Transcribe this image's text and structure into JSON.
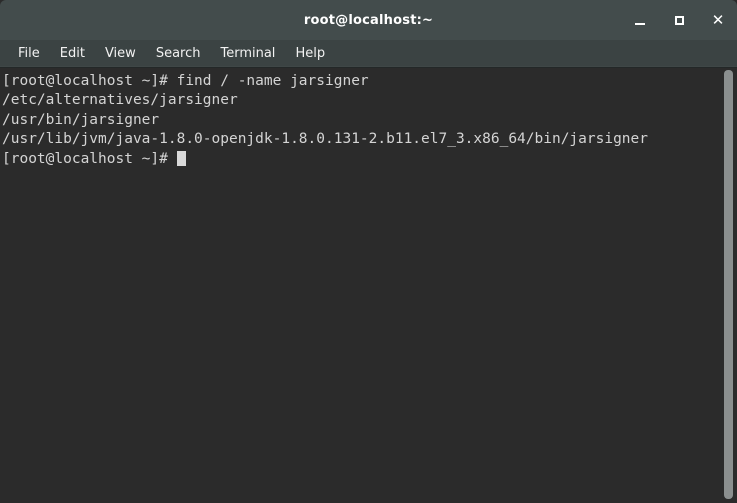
{
  "window": {
    "title": "root@localhost:~",
    "controls": {
      "minimize_label": "_",
      "maximize_label": "□",
      "close_label": "✕"
    }
  },
  "menubar": {
    "items": [
      {
        "label": "File"
      },
      {
        "label": "Edit"
      },
      {
        "label": "View"
      },
      {
        "label": "Search"
      },
      {
        "label": "Terminal"
      },
      {
        "label": "Help"
      }
    ]
  },
  "terminal": {
    "lines": [
      "[root@localhost ~]# find / -name jarsigner",
      "/etc/alternatives/jarsigner",
      "/usr/bin/jarsigner",
      "/usr/lib/jvm/java-1.8.0-openjdk-1.8.0.131-2.b11.el7_3.x86_64/bin/jarsigner"
    ],
    "prompt": "[root@localhost ~]# ",
    "foreground_color": "#d4d4d4",
    "background_color": "#2b2b2b"
  },
  "colors": {
    "titlebar": "#434c4c",
    "menubar": "#3b4343",
    "terminal_bg": "#2b2b2b",
    "scrollbar_thumb": "#8b8f8f"
  }
}
